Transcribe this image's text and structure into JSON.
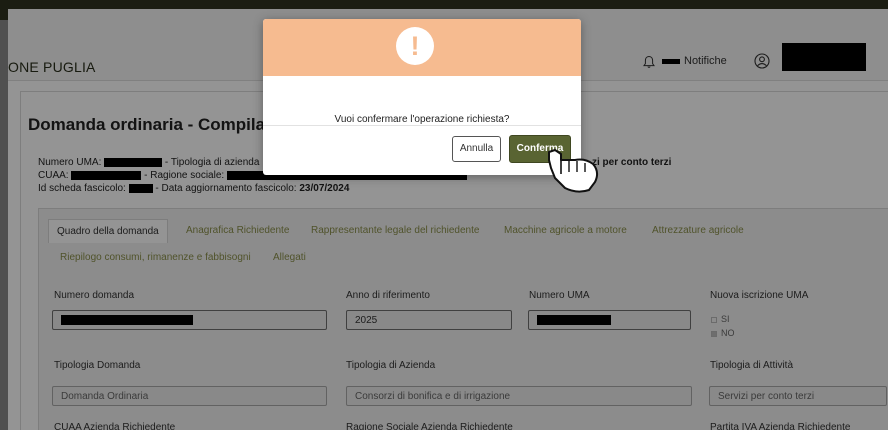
{
  "header": {
    "region_title": "ONE PUGLIA",
    "notifications_label": "Notifiche"
  },
  "page": {
    "title": "Domanda ordinaria - Compilazione",
    "numero_uma_label": "Numero UMA:",
    "tipologia_label": "- Tipologia di azienda",
    "tipologia_value_visible": "zi per conto terzi",
    "cuaa_label": "CUAA:",
    "ragione_label": "- Ragione sociale:",
    "id_scheda_label": "Id scheda fascicolo:",
    "data_agg_label": "- Data aggiornamento fascicolo:",
    "data_agg_value": "23/07/2024"
  },
  "tabs": {
    "quadro": "Quadro della domanda",
    "anagrafica": "Anagrafica Richiedente",
    "rappresentante": "Rappresentante legale del richiedente",
    "macchine": "Macchine agricole a motore",
    "attrezzature": "Attrezzature agricole",
    "riepilogo": "Riepilogo consumi, rimanenze e fabbisogni",
    "allegati": "Allegati"
  },
  "form": {
    "numero_domanda_label": "Numero domanda",
    "anno_label": "Anno di riferimento",
    "anno_value": "2025",
    "numero_uma_label": "Numero UMA",
    "nuova_iscrizione_label": "Nuova iscrizione UMA",
    "opt_si": "SI",
    "opt_no": "NO",
    "nuova_iscrizione_selected": "NO",
    "tipologia_domanda_label": "Tipologia Domanda",
    "tipologia_domanda_value": "Domanda Ordinaria",
    "tipologia_azienda_label": "Tipologia di Azienda",
    "tipologia_azienda_value": "Consorzi di bonifica e di irrigazione",
    "tipologia_attivita_label": "Tipologia di Attività",
    "tipologia_attivita_value": "Servizi per conto terzi",
    "cuaa_azienda_label": "CUAA Azienda Richiedente",
    "ragione_sociale_label": "Ragione Sociale Azienda Richiedente",
    "partita_iva_label": "Partita IVA Azienda Richiedente"
  },
  "modal": {
    "icon": "exclamation-icon",
    "message": "Vuoi confermare l'operazione richiesta?",
    "cancel_label": "Annulla",
    "confirm_label": "Conferma"
  },
  "colors": {
    "modal_header": "#f6bb90",
    "confirm_button": "#596432",
    "tab_link": "#8a8f4a",
    "topbar": "#2f3320"
  }
}
